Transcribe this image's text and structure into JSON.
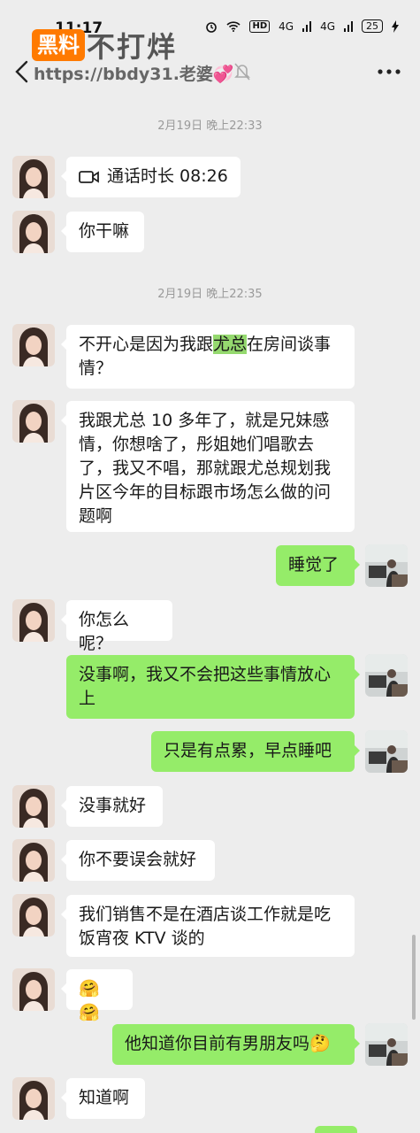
{
  "status_bar": {
    "time": "11:17",
    "hd": "HD",
    "signal1": "4G",
    "signal2": "4G",
    "battery": "25"
  },
  "watermark": {
    "badge": "黑料",
    "text": "不打烊"
  },
  "header": {
    "title": "https://bbdy31.老婆💞"
  },
  "timestamps": [
    "2月19日 晚上22:33",
    "2月19日 晚上22:35"
  ],
  "messages": [
    {
      "id": "m1",
      "sender": "her",
      "text": "通话时长 08:26"
    },
    {
      "id": "m2",
      "sender": "her",
      "text": "你干嘛"
    },
    {
      "id": "m3",
      "sender": "her",
      "pre": "不开心是因为我跟",
      "highlight": "尤总",
      "post": "在房间谈事情？"
    },
    {
      "id": "m4",
      "sender": "her",
      "text": "我跟尤总 10 多年了，就是兄妹感情，你想啥了，彤姐她们唱歌去了，我又不唱，那就跟尤总规划我片区今年的目标跟市场怎么做的问题啊"
    },
    {
      "id": "m5",
      "sender": "me",
      "text": "睡觉了"
    },
    {
      "id": "m6",
      "sender": "her",
      "text": "你怎么呢？"
    },
    {
      "id": "m7",
      "sender": "me",
      "text": "没事啊，我又不会把这些事情放心上"
    },
    {
      "id": "m8",
      "sender": "me",
      "text": "只是有点累，早点睡吧"
    },
    {
      "id": "m9",
      "sender": "her",
      "text": "没事就好"
    },
    {
      "id": "m10",
      "sender": "her",
      "text": "你不要误会就好"
    },
    {
      "id": "m11",
      "sender": "her",
      "text": "我们销售不是在酒店谈工作就是吃饭宵夜 KTV 谈的"
    },
    {
      "id": "m12",
      "sender": "her",
      "text": "🤗🤗"
    },
    {
      "id": "m13",
      "sender": "me",
      "text": "他知道你目前有男朋友吗🤔"
    },
    {
      "id": "m14",
      "sender": "her",
      "text": "知道啊"
    }
  ],
  "colors": {
    "background": "#ededed",
    "bubble_left": "#ffffff",
    "bubble_right": "#95ec69",
    "highlight": "#95d96f",
    "watermark": "#ff7a00"
  }
}
